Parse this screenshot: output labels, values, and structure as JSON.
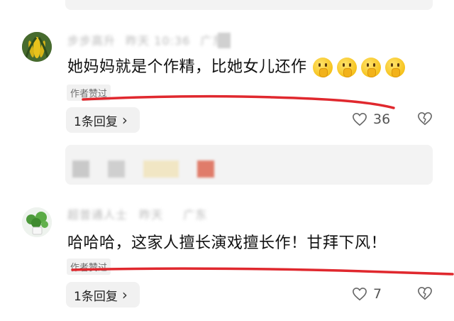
{
  "comments": [
    {
      "author": "步步高升",
      "time": "昨天 10:36",
      "location": "广东",
      "text": "她妈妈就是个作精，比她女儿还作",
      "emojis": [
        "shushing-face-emoji",
        "shushing-face-emoji",
        "shushing-face-emoji",
        "shushing-face-emoji"
      ],
      "badge": "作者赞过",
      "reply_label": "1条回复",
      "reply_arrow": "›",
      "likes": "36"
    },
    {
      "author": "超普通人士",
      "time": "昨天",
      "location": "广东",
      "text": "哈哈哈，这家人擅长演戏擅长作！甘拜下风！",
      "badge": "作者赞过",
      "reply_label": "1条回复",
      "reply_arrow": "›",
      "likes": "7"
    }
  ],
  "colors": {
    "annotation_red": "#e0282e",
    "card_gray": "#f3f3f3"
  }
}
